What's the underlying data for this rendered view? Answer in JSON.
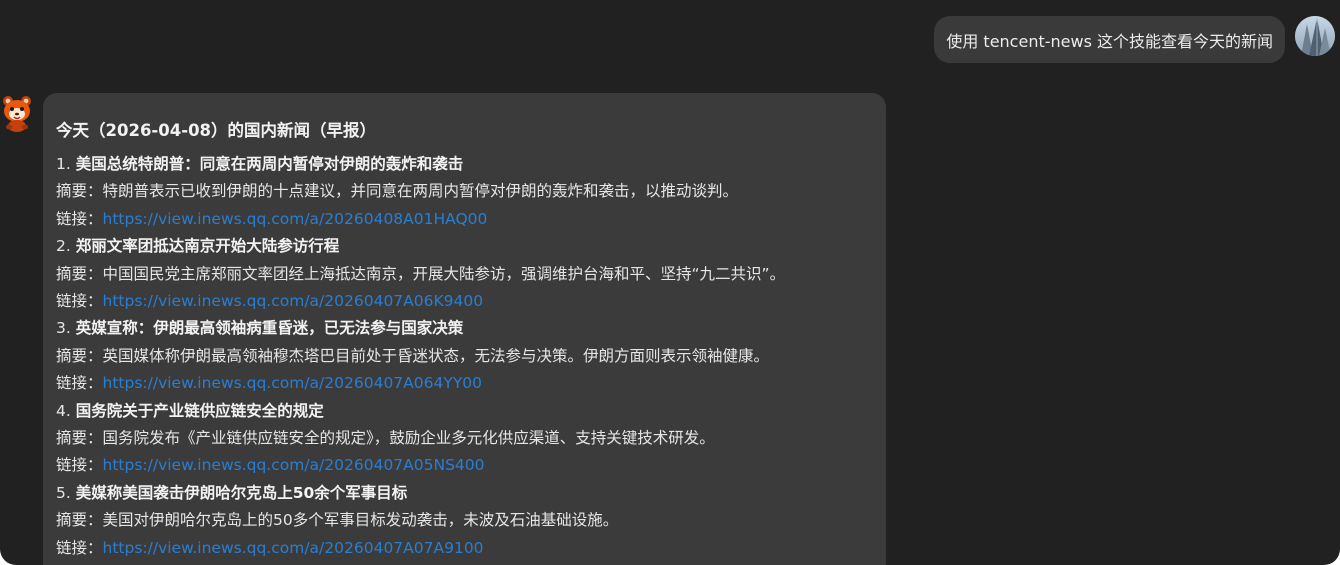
{
  "user_message": {
    "text": "使用 tencent-news 这个技能查看今天的新闻"
  },
  "assistant_message": {
    "heading": "今天（2026-04-08）的国内新闻（早报）",
    "summary_prefix": "摘要：",
    "link_prefix": "链接：",
    "items": [
      {
        "number": "1.",
        "title": "美国总统特朗普：同意在两周内暂停对伊朗的轰炸和袭击",
        "summary": "特朗普表示已收到伊朗的十点建议，并同意在两周内暂停对伊朗的轰炸和袭击，以推动谈判。",
        "link": "https://view.inews.qq.com/a/20260408A01HAQ00"
      },
      {
        "number": "2.",
        "title": "郑丽文率团抵达南京开始大陆参访行程",
        "summary": "中国国民党主席郑丽文率团经上海抵达南京，开展大陆参访，强调维护台海和平、坚持“九二共识”。",
        "link": "https://view.inews.qq.com/a/20260407A06K9400"
      },
      {
        "number": "3.",
        "title": "英媒宣称：伊朗最高领袖病重昏迷，已无法参与国家决策",
        "summary": "英国媒体称伊朗最高领袖穆杰塔巴目前处于昏迷状态，无法参与决策。伊朗方面则表示领袖健康。",
        "link": "https://view.inews.qq.com/a/20260407A064YY00"
      },
      {
        "number": "4.",
        "title": "国务院关于产业链供应链安全的规定",
        "summary": "国务院发布《产业链供应链安全的规定》，鼓励企业多元化供应渠道、支持关键技术研发。",
        "link": "https://view.inews.qq.com/a/20260407A05NS400"
      },
      {
        "number": "5.",
        "title": "美媒称美国袭击伊朗哈尔克岛上50余个军事目标",
        "summary": "美国对伊朗哈尔克岛上的50多个军事目标发动袭击，未波及石油基础设施。",
        "link": "https://view.inews.qq.com/a/20260407A07A9100"
      }
    ]
  },
  "colors": {
    "background": "#212121",
    "user_bubble": "#3a3a3a",
    "assistant_bubble": "#3b3b3b",
    "link": "#2a7ed2"
  },
  "icons": {
    "user_avatar": "user-avatar-photo",
    "assistant_avatar": "red-panda-mascot-icon"
  }
}
